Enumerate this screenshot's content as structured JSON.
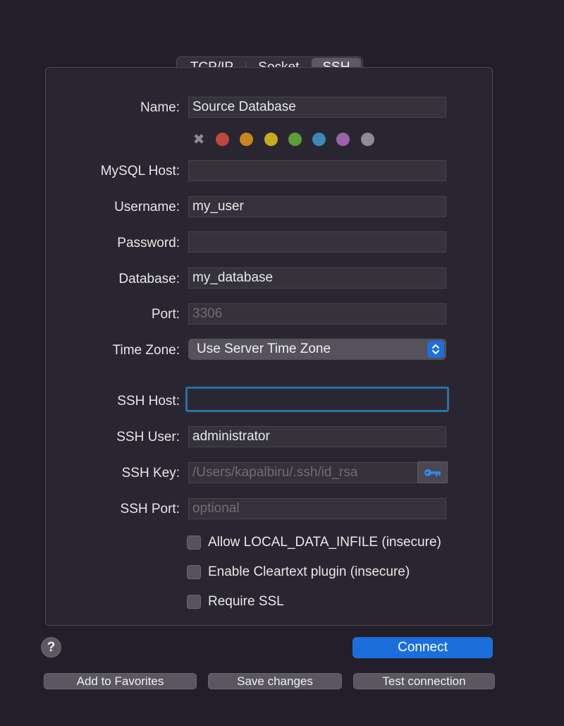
{
  "tabs": [
    {
      "label": "TCP/IP"
    },
    {
      "label": "Socket"
    },
    {
      "label": "SSH",
      "selected": true
    }
  ],
  "form": {
    "name": {
      "label": "Name:",
      "value": "Source Database"
    },
    "mysql_host": {
      "label": "MySQL Host:",
      "value": ""
    },
    "username": {
      "label": "Username:",
      "value": "my_user"
    },
    "password": {
      "label": "Password:",
      "value": ""
    },
    "database": {
      "label": "Database:",
      "value": "my_database"
    },
    "port": {
      "label": "Port:",
      "value": "",
      "placeholder": "3306"
    },
    "time_zone": {
      "label": "Time Zone:",
      "value": "Use Server Time Zone"
    },
    "ssh_host": {
      "label": "SSH Host:",
      "value": ""
    },
    "ssh_user": {
      "label": "SSH User:",
      "value": "administrator"
    },
    "ssh_key": {
      "label": "SSH Key:",
      "value": "",
      "placeholder": "/Users/kapalbiru/.ssh/id_rsa"
    },
    "ssh_port": {
      "label": "SSH Port:",
      "value": "",
      "placeholder": "optional"
    }
  },
  "color_tags": {
    "none_symbol": "✖",
    "colors": [
      "#c0473d",
      "#c8861f",
      "#c7ac22",
      "#5e9c3a",
      "#3f86b9",
      "#9a63a8",
      "#8e8c91"
    ]
  },
  "checkboxes": [
    {
      "label": "Allow LOCAL_DATA_INFILE (insecure)",
      "checked": false
    },
    {
      "label": "Enable Cleartext plugin (insecure)",
      "checked": false
    },
    {
      "label": "Require SSL",
      "checked": false
    }
  ],
  "buttons": {
    "help": "?",
    "connect": "Connect",
    "add_to_favorites": "Add to Favorites",
    "save_changes": "Save changes",
    "test_connection": "Test connection"
  },
  "icons": {
    "key": "key-icon",
    "stepper": "chevron-up-down-icon"
  }
}
